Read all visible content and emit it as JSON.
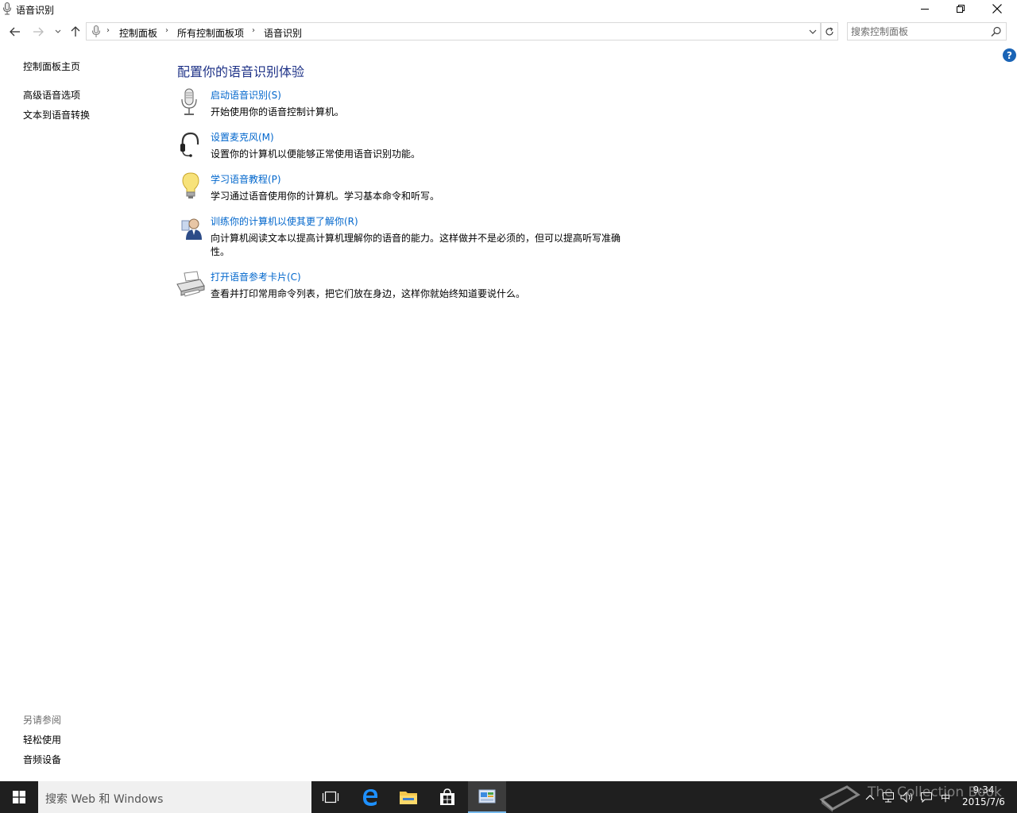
{
  "window": {
    "title": "语音识别"
  },
  "navigation": {
    "breadcrumbs": [
      "控制面板",
      "所有控制面板项",
      "语音识别"
    ],
    "search_placeholder": "搜索控制面板"
  },
  "left_pane": {
    "home_link": "控制面板主页",
    "links": [
      "高级语音选项",
      "文本到语音转换"
    ],
    "see_also_title": "另请参阅",
    "see_also_links": [
      "轻松使用",
      "音频设备"
    ]
  },
  "main": {
    "title": "配置你的语音识别体验",
    "tasks": [
      {
        "icon": "microphone-icon",
        "link": "启动语音识别(S)",
        "description": "开始使用你的语音控制计算机。"
      },
      {
        "icon": "headset-icon",
        "link": "设置麦克风(M)",
        "description": "设置你的计算机以便能够正常使用语音识别功能。"
      },
      {
        "icon": "lightbulb-icon",
        "link": "学习语音教程(P)",
        "description": "学习通过语音使用你的计算机。学习基本命令和听写。"
      },
      {
        "icon": "user-training-icon",
        "link": "训练你的计算机以使其更了解你(R)",
        "description": "向计算机阅读文本以提高计算机理解你的语音的能力。这样做并不是必须的，但可以提高听写准确性。"
      },
      {
        "icon": "printer-icon",
        "link": "打开语音参考卡片(C)",
        "description": "查看并打印常用命令列表，把它们放在身边，这样你就始终知道要说什么。"
      }
    ]
  },
  "taskbar": {
    "search_text": "搜索 Web 和 Windows",
    "ime": "中",
    "time": "9:34",
    "date": "2015/7/6"
  },
  "watermark": "The Collection Book",
  "colors": {
    "link": "#0066cc",
    "title": "#1e3287",
    "taskbar": "#1f1f1f",
    "help": "#1a64b6"
  }
}
